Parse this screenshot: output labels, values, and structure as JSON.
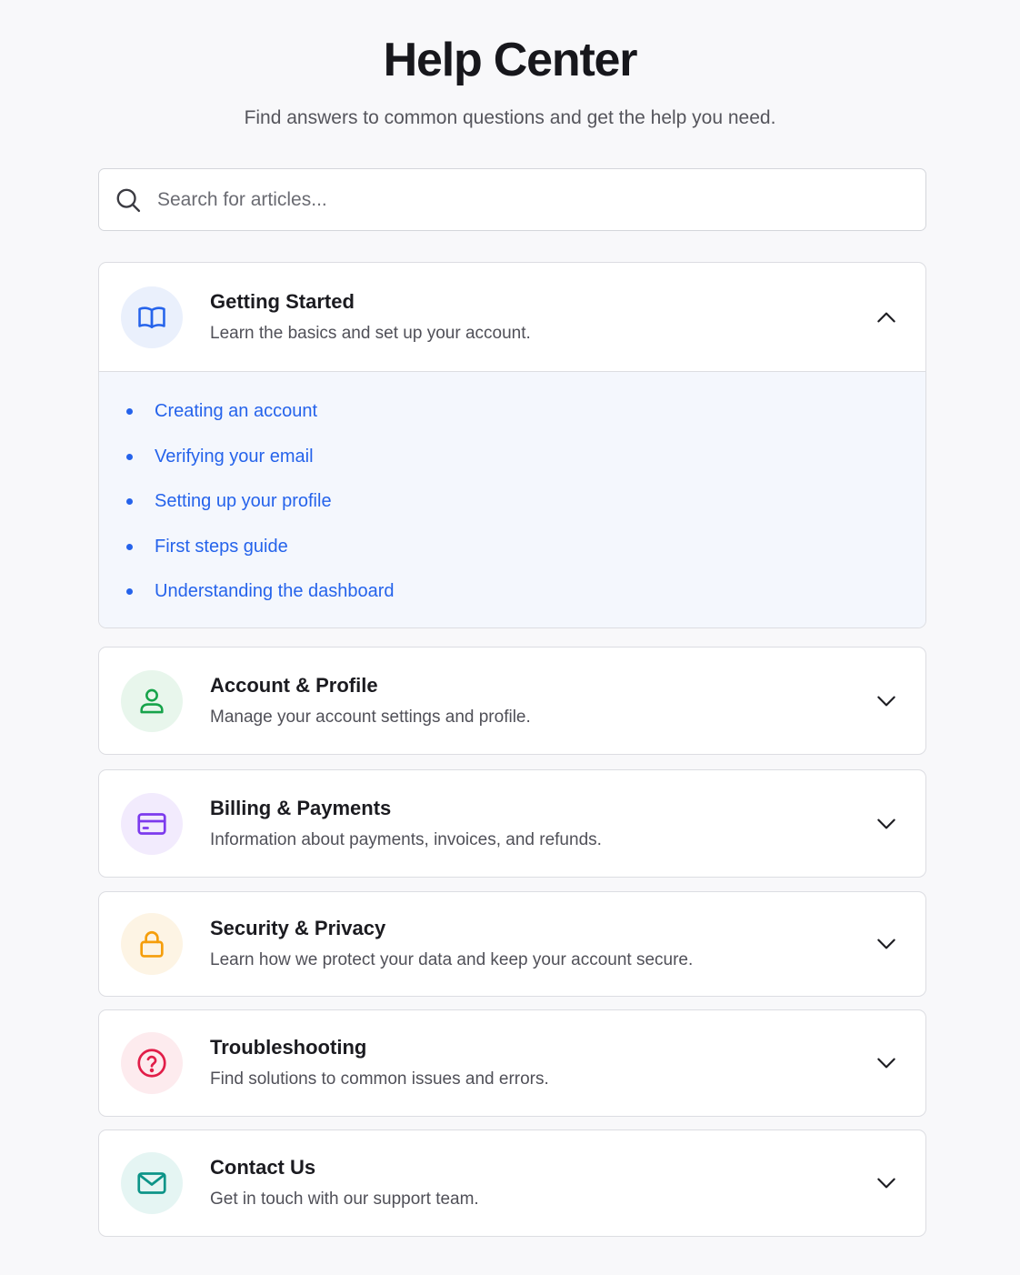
{
  "header": {
    "title": "Help Center",
    "subtitle": "Find answers to common questions and get the help you need."
  },
  "search": {
    "placeholder": "Search for articles...",
    "value": "",
    "icon": "search-icon"
  },
  "sections": [
    {
      "title": "Getting Started",
      "description": "Learn the basics and set up your account.",
      "icon": "book-icon",
      "icon_color": "#2563eb",
      "icon_bg": "#eaf0fc",
      "expanded": true,
      "articles": [
        "Creating an account",
        "Verifying your email",
        "Setting up your profile",
        "First steps guide",
        "Understanding the dashboard"
      ]
    },
    {
      "title": "Account & Profile",
      "description": "Manage your account settings and profile.",
      "icon": "user-icon",
      "icon_color": "#16a34a",
      "icon_bg": "#e8f6ec",
      "expanded": false
    },
    {
      "title": "Billing & Payments",
      "description": "Information about payments, invoices, and refunds.",
      "icon": "credit-card-icon",
      "icon_color": "#7c3aed",
      "icon_bg": "#f2ebfd",
      "expanded": false
    },
    {
      "title": "Security & Privacy",
      "description": "Learn how we protect your data and keep your account secure.",
      "icon": "lock-icon",
      "icon_color": "#f59e0b",
      "icon_bg": "#fdf4e4",
      "expanded": false
    },
    {
      "title": "Troubleshooting",
      "description": "Find solutions to common issues and errors.",
      "icon": "question-circle-icon",
      "icon_color": "#e11d48",
      "icon_bg": "#fdebee",
      "expanded": false
    },
    {
      "title": "Contact Us",
      "description": "Get in touch with our support team.",
      "icon": "mail-icon",
      "icon_color": "#0d9488",
      "icon_bg": "#e5f5f3",
      "expanded": false
    }
  ],
  "colors": {
    "link": "#2563eb",
    "background": "#f8f8fa",
    "expanded_body": "#f4f7fd"
  }
}
